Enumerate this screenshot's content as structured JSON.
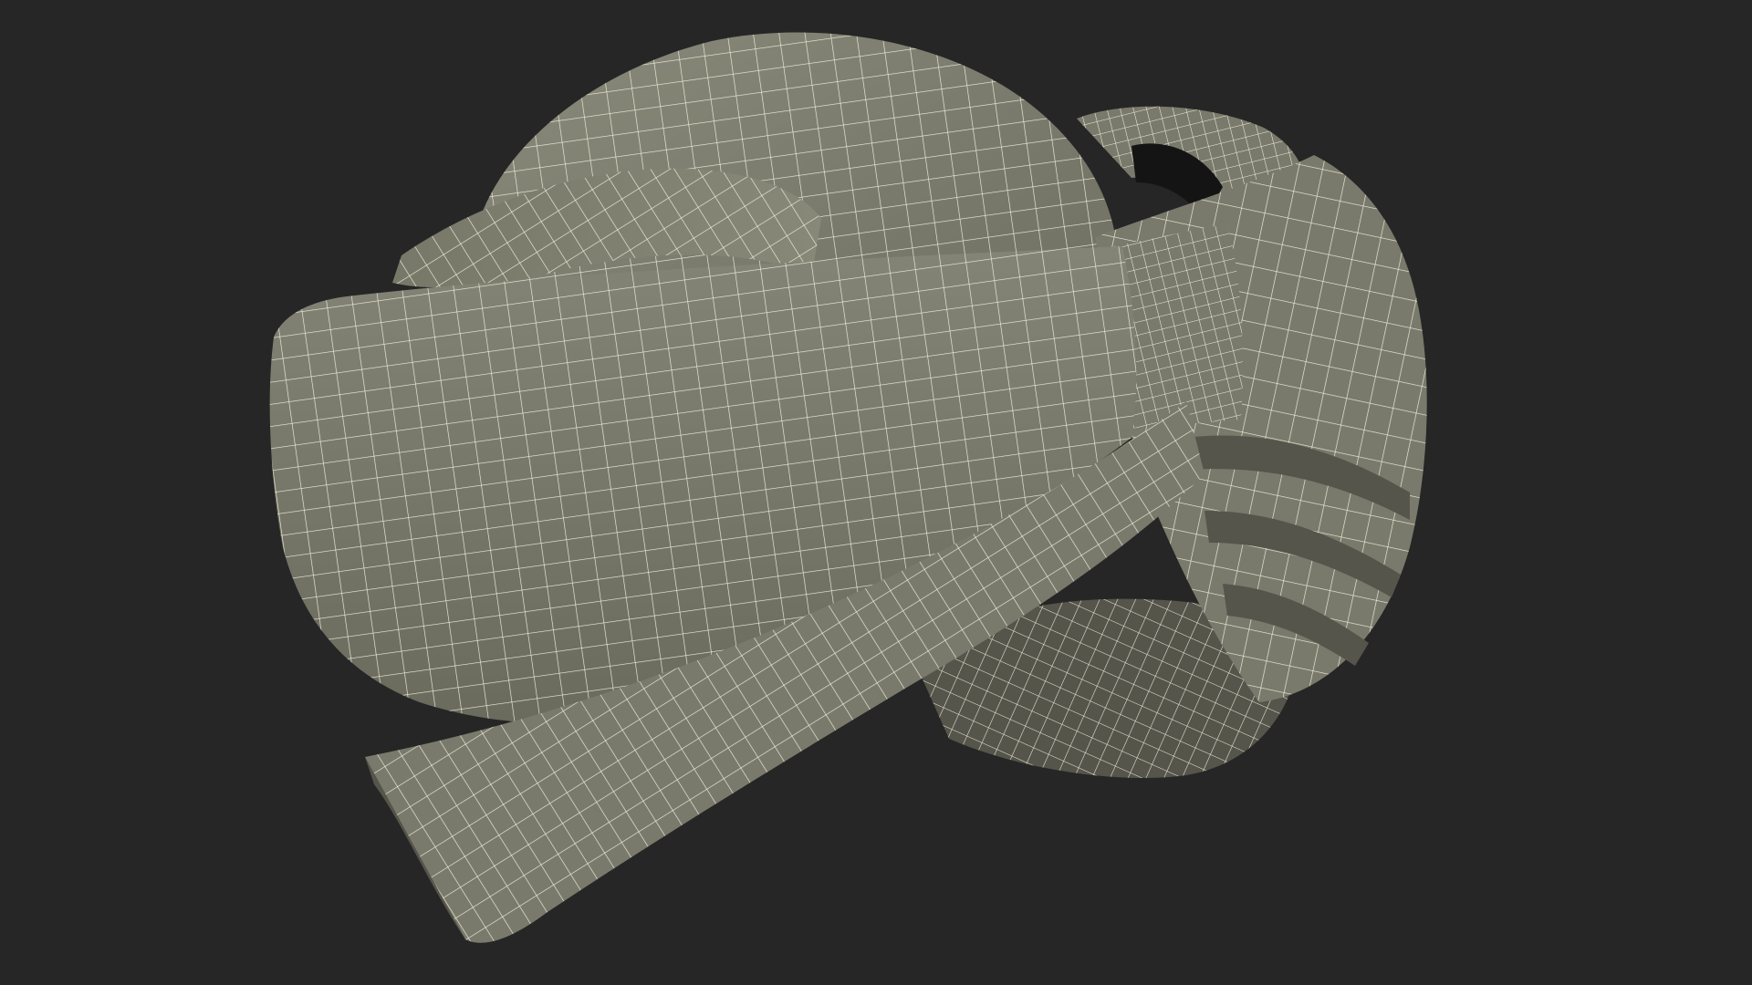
{
  "scene": {
    "subject": "turban-wireframe-model",
    "colors": {
      "background": "#262626",
      "surface": "#7a7a6c",
      "surface_dark": "#55554b",
      "shadow": "#141414",
      "wire": "#f1efdc"
    }
  }
}
